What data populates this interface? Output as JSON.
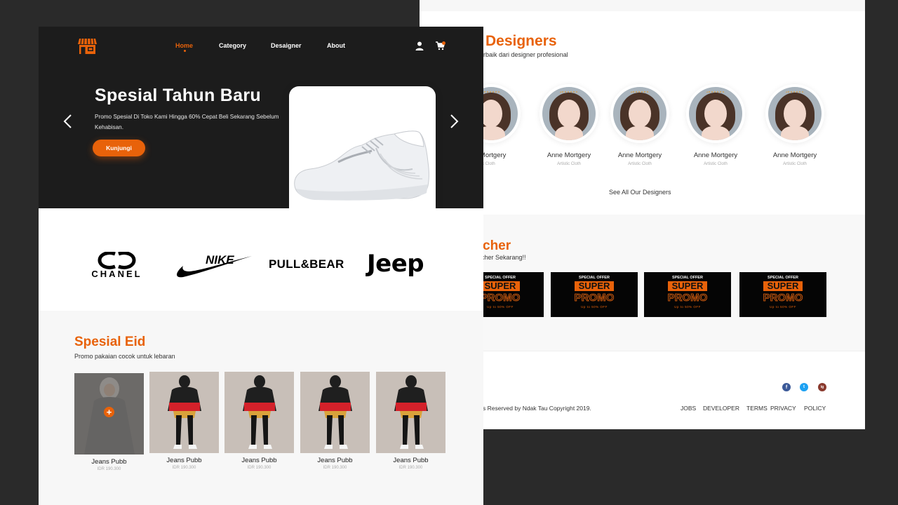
{
  "nav": {
    "items": [
      "Home",
      "Category",
      "Desaigner",
      "About"
    ]
  },
  "hero": {
    "title": "Spesial Tahun Baru",
    "description": "Promo Spesial Di Toko Kami Hingga 60%  Cepat Beli Sekarang Sebelum Kehabisan.",
    "button": "Kunjungi"
  },
  "brands": [
    "CHANEL",
    "NIKE",
    "PULL&BEAR",
    "Jeep"
  ],
  "eid": {
    "title": "Spesial Eid",
    "subtitle": "Promo pakaian cocok untuk lebaran",
    "products": [
      {
        "name": "Jeans Pubb",
        "price": "IDR 190.300"
      },
      {
        "name": "Jeans Pubb",
        "price": "IDR 190.300"
      },
      {
        "name": "Jeans Pubb",
        "price": "IDR 190.300"
      },
      {
        "name": "Jeans Pubb",
        "price": "IDR 190.300"
      },
      {
        "name": "Jeans Pubb",
        "price": "IDR 190.300"
      }
    ]
  },
  "designers": {
    "title": "Designers",
    "subtitle": "erbaik dari designer profesional",
    "items": [
      {
        "name": "e Mortgery",
        "role": "rtistic Cloth"
      },
      {
        "name": "Anne Mortgery",
        "role": "Artistic Cloth"
      },
      {
        "name": "Anne Mortgery",
        "role": "Artistic Cloth"
      },
      {
        "name": "Anne Mortgery",
        "role": "Artistic Cloth"
      },
      {
        "name": "Anne Mortgery",
        "role": "Artistic Cloth"
      }
    ],
    "see_all": "See All Our Designers"
  },
  "voucher": {
    "title": "cher",
    "subtitle": "cher Sekarang!!",
    "cards": [
      {
        "top": "SPECIAL OFFER",
        "super": "SUPER",
        "promo": "PROMO",
        "off": "Up to 50% OFF"
      },
      {
        "top": "SPECIAL OFFER",
        "super": "SUPER",
        "promo": "PROMO",
        "off": "Up to 50% OFF"
      },
      {
        "top": "SPECIAL OFFER",
        "super": "SUPER",
        "promo": "PROMO",
        "off": "Up to 50% OFF"
      },
      {
        "top": "SPECIAL OFFER",
        "super": "SUPER",
        "promo": "PROMO",
        "off": "Up to 50% OFF"
      }
    ]
  },
  "footer": {
    "copyright": "s Reserved by Ndak Tau  Copyright 2019.",
    "links": [
      "JOBS",
      "DEVELOPER",
      "TERMS",
      "PRIVACY",
      "POLICY"
    ],
    "social": [
      "f",
      "t",
      "ig"
    ]
  },
  "colors": {
    "accent": "#e8620a",
    "hero_bg": "#1c1c1c",
    "page_bg": "#2a2a2a",
    "facebook": "#3b5998",
    "twitter": "#1da1f2",
    "instagram": "#8a3a2e"
  }
}
